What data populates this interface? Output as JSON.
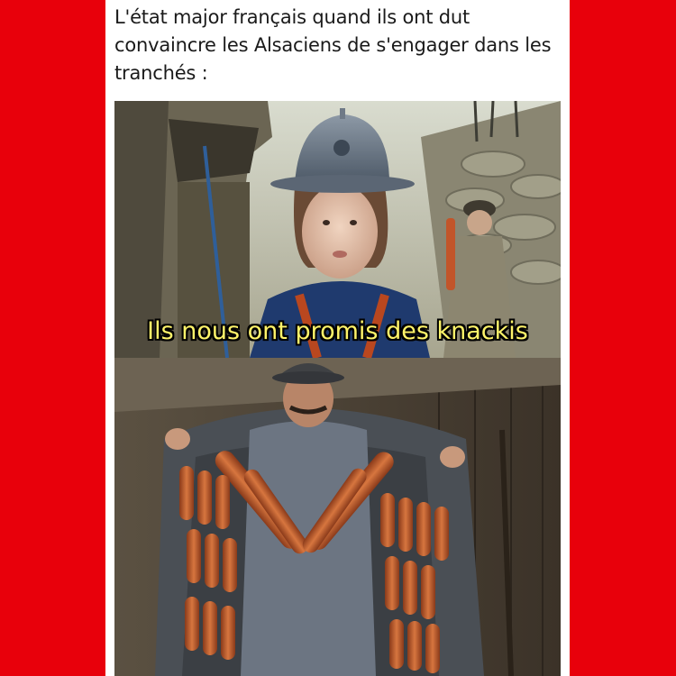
{
  "meme": {
    "caption": "L'état major français quand ils ont dut convaincre les Alsaciens de s'engager dans les tranchés :",
    "subtitle": "Ils nous ont promis des knackis"
  },
  "colors": {
    "frame": "#e8000b",
    "card": "#ffffff",
    "subtitle_text": "#fff46a"
  },
  "images": {
    "top": "child-in-adrian-helmet-in-trench-photo",
    "bottom": "soldier-coat-lined-with-sausages-photo"
  }
}
